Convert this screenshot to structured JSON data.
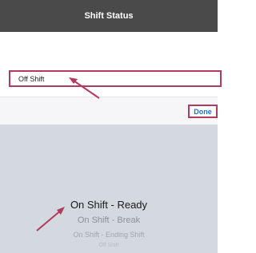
{
  "header": {
    "title": "Shift Status"
  },
  "status_field": {
    "value": "Off Shift"
  },
  "toolbar": {
    "done_label": "Done"
  },
  "picker": {
    "options": [
      "On Shift - Ready",
      "On Shift - Break",
      "On Shift - Ending Shift",
      "Off Shift"
    ],
    "selected": "On Shift - Ready"
  },
  "colors": {
    "header_bg": "#4a4a4a",
    "annotation": "#b23a5e",
    "done_text": "#1a6fd6",
    "picker_bg": "#d4d8df"
  }
}
